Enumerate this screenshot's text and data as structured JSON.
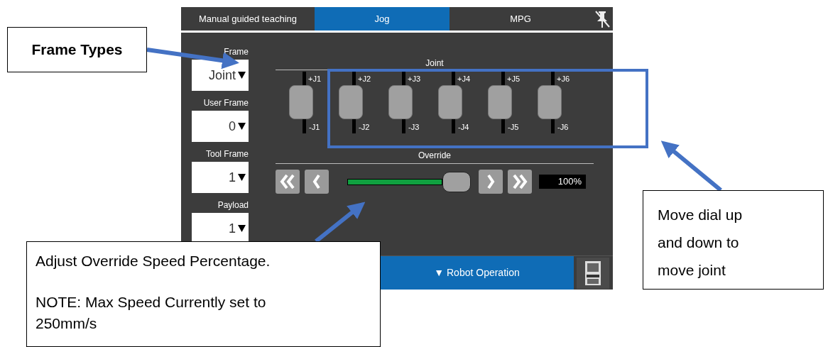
{
  "tabs": [
    {
      "label": "Manual guided teaching",
      "selected": false
    },
    {
      "label": "Jog",
      "selected": true
    },
    {
      "label": "MPG",
      "selected": false
    }
  ],
  "frame_fields": [
    {
      "label": "Frame",
      "value": "Joint"
    },
    {
      "label": "User Frame",
      "value": "0"
    },
    {
      "label": "Tool Frame",
      "value": "1"
    },
    {
      "label": "Payload",
      "value": "1"
    }
  ],
  "joint": {
    "title": "Joint",
    "sliders": [
      {
        "plus": "+J1",
        "minus": "-J1"
      },
      {
        "plus": "+J2",
        "minus": "-J2"
      },
      {
        "plus": "+J3",
        "minus": "-J3"
      },
      {
        "plus": "+J4",
        "minus": "-J4"
      },
      {
        "plus": "+J5",
        "minus": "-J5"
      },
      {
        "plus": "+J6",
        "minus": "-J6"
      }
    ]
  },
  "override": {
    "title": "Override",
    "level": 1,
    "value": "100%"
  },
  "bottom_bar": {
    "label": "▼ Robot Operation"
  },
  "annotations": [
    {
      "kind": "title",
      "text": "Frame Types"
    },
    {
      "kind": "note",
      "text": "Move dial up and down to move joint"
    },
    {
      "kind": "callout",
      "lines": [
        "Adjust Override Speed Percentage.",
        "NOTE: Max Speed Currently set to 250mm/s"
      ]
    }
  ]
}
